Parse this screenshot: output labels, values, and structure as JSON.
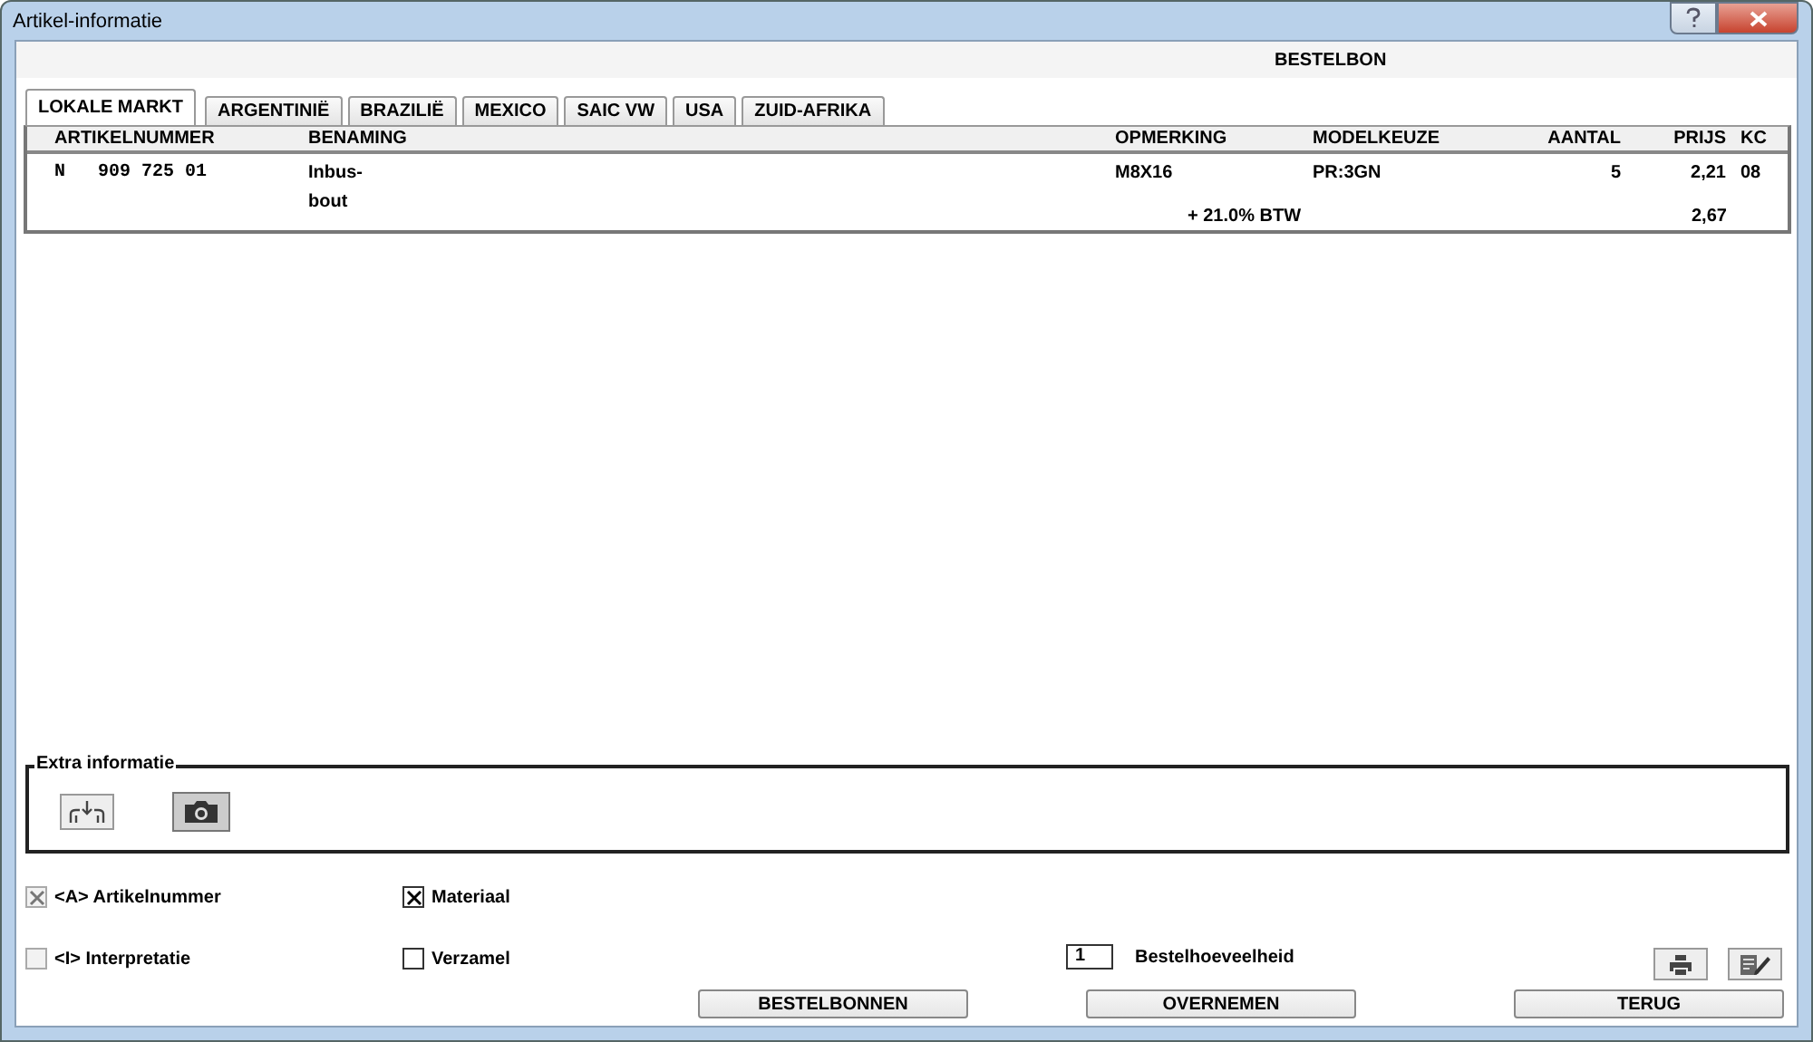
{
  "window": {
    "title": "Artikel-informatie"
  },
  "header": "BESTELBON",
  "tabs": [
    {
      "label": "LOKALE MARKT",
      "selected": true
    },
    {
      "label": "ARGENTINIË",
      "selected": false
    },
    {
      "label": "BRAZILIË",
      "selected": false
    },
    {
      "label": "MEXICO",
      "selected": false
    },
    {
      "label": "SAIC VW",
      "selected": false
    },
    {
      "label": "USA",
      "selected": false
    },
    {
      "label": "ZUID-AFRIKA",
      "selected": false
    }
  ],
  "table": {
    "columns": [
      "ARTIKELNUMMER",
      "BENAMING",
      "OPMERKING",
      "MODELKEUZE",
      "AANTAL",
      "PRIJS",
      "KC"
    ],
    "rows": [
      {
        "cells": [
          "N   909 725 01",
          "Inbus-\nbout",
          "M8X16",
          "PR:3GN",
          "5",
          "2,21",
          "08"
        ]
      }
    ],
    "tax": {
      "label": "+ 21.0% BTW",
      "amount": "2,67"
    }
  },
  "extra_info": {
    "title": "Extra informatie"
  },
  "options": [
    {
      "label": "<A> Artikelnummer",
      "checked": true,
      "disabled": true
    },
    {
      "label": "Materiaal",
      "checked": true,
      "disabled": false
    },
    {
      "label": "<I> Interpretatie",
      "checked": false,
      "disabled": true
    },
    {
      "label": "Verzamel",
      "checked": false,
      "disabled": false
    }
  ],
  "quantity": {
    "value": "1",
    "label": "Bestelhoeveelheid"
  },
  "buttons": [
    "BESTELBONNEN",
    "OVERNEMEN",
    "TERUG"
  ]
}
